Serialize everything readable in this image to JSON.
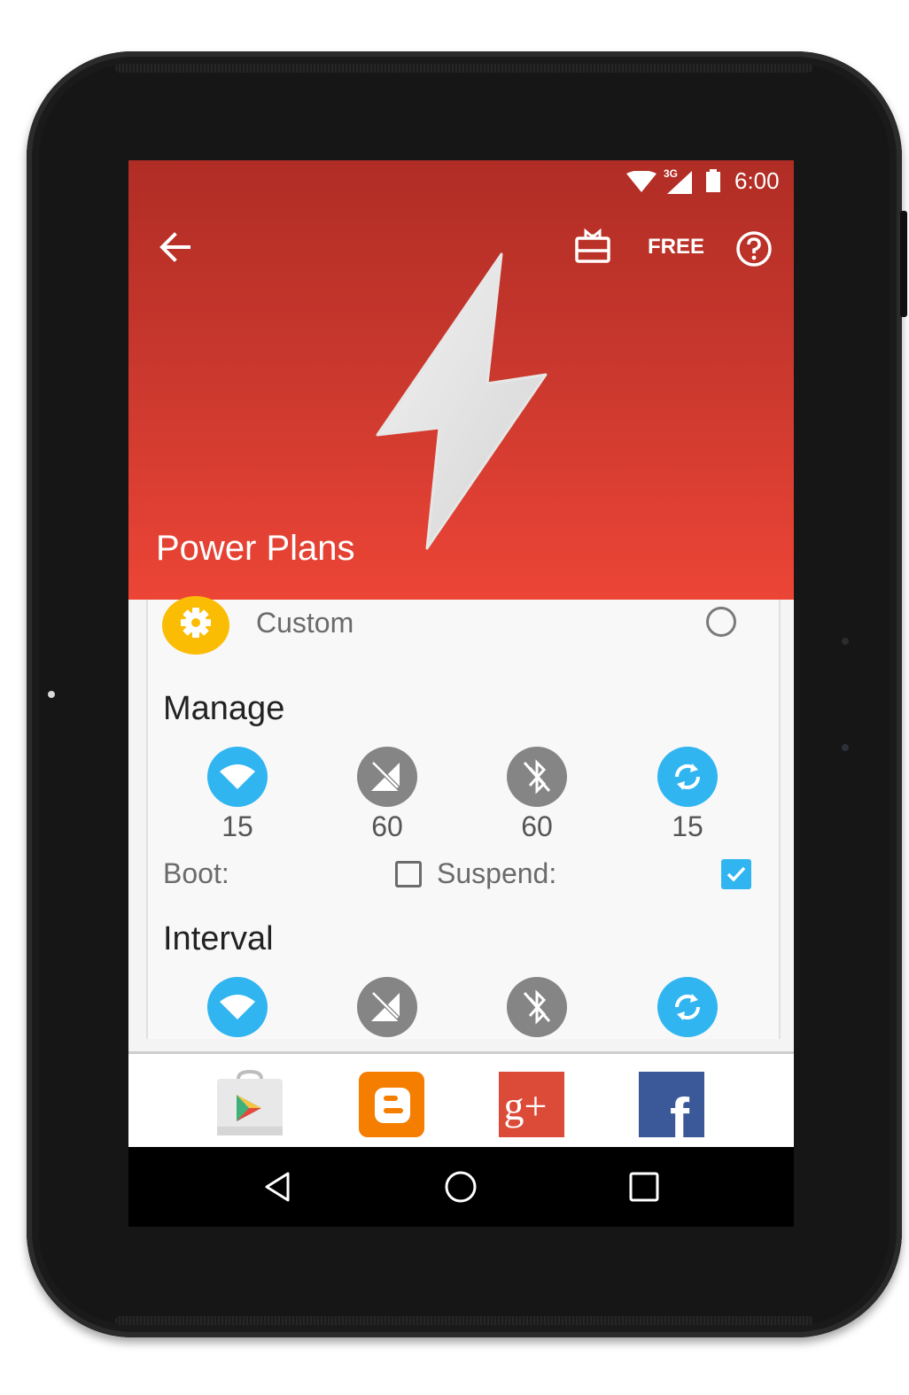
{
  "status_bar": {
    "network": "3G",
    "time": "6:00"
  },
  "toolbar": {
    "free_label": "FREE"
  },
  "header": {
    "title": "Power Plans"
  },
  "plan": {
    "label": "Custom",
    "selected": false
  },
  "manage": {
    "title": "Manage",
    "items": [
      {
        "icon": "wifi-icon",
        "value": "15",
        "enabled": true
      },
      {
        "icon": "mobile-data-off-icon",
        "value": "60",
        "enabled": false
      },
      {
        "icon": "bluetooth-off-icon",
        "value": "60",
        "enabled": false
      },
      {
        "icon": "sync-icon",
        "value": "15",
        "enabled": true
      }
    ],
    "boot_label": "Boot:",
    "boot_checked": false,
    "suspend_label": "Suspend:",
    "suspend_checked": true
  },
  "interval": {
    "title": "Interval",
    "items": [
      {
        "icon": "wifi-icon",
        "enabled": true
      },
      {
        "icon": "mobile-data-off-icon",
        "enabled": false
      },
      {
        "icon": "bluetooth-off-icon",
        "enabled": false
      },
      {
        "icon": "sync-icon",
        "enabled": true
      }
    ]
  },
  "social": [
    {
      "icon": "google-play-icon"
    },
    {
      "icon": "blogger-icon"
    },
    {
      "icon": "google-plus-icon",
      "label": "g+"
    },
    {
      "icon": "facebook-icon",
      "label": "f"
    }
  ],
  "colors": {
    "header_top": "#b02d25",
    "header_bottom": "#ec4536",
    "accent_blue": "#31b5f1",
    "disabled_grey": "#858585",
    "gear_yellow": "#fbbc04"
  }
}
